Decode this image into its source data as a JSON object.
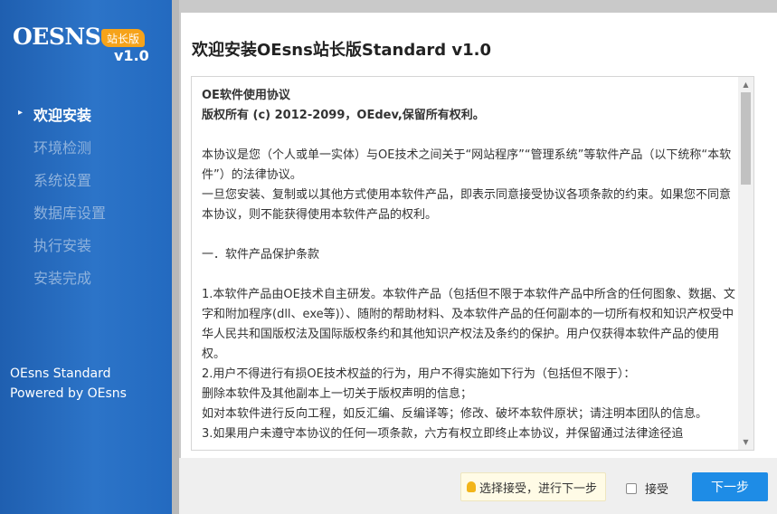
{
  "sidebar": {
    "logo_text": "OESNS",
    "logo_badge": "站长版",
    "version": "v1.0",
    "steps": [
      {
        "label": "欢迎安装",
        "active": true
      },
      {
        "label": "环境检测",
        "active": false
      },
      {
        "label": "系统设置",
        "active": false
      },
      {
        "label": "数据库设置",
        "active": false
      },
      {
        "label": "执行安装",
        "active": false
      },
      {
        "label": "安装完成",
        "active": false
      }
    ],
    "product_name": "OEsns Standard",
    "powered_by": "Powered by OEsns"
  },
  "main": {
    "title": "欢迎安装OEsns站长版Standard v1.0",
    "license": {
      "heading": "OE软件使用协议",
      "copyright": "版权所有 (c) 2012-2099，OEdev,保留所有权利。",
      "p1": "本协议是您（个人或单一实体）与OE技术之间关于“网站程序”“管理系统”等软件产品（以下统称“本软件”）的法律协议。",
      "p2": "一旦您安装、复制或以其他方式使用本软件产品，即表示同意接受协议各项条款的约束。如果您不同意本协议，则不能获得使用本软件产品的权利。",
      "section1": "一．软件产品保护条款",
      "p3": "1.本软件产品由OE技术自主研发。本软件产品（包括但不限于本软件产品中所含的任何图象、数据、文字和附加程序(dll、exe等)）、随附的帮助材料、及本软件产品的任何副本的一切所有权和知识产权受中华人民共和国版权法及国际版权条约和其他知识产权法及条约的保护。用户仅获得本软件产品的使用权。",
      "p4": "2.用户不得进行有损OE技术权益的行为，用户不得实施如下行为（包括但不限于）：",
      "p5": "删除本软件及其他副本上一切关于版权声明的信息；",
      "p6": "如对本软件进行反向工程，如反汇编、反编译等；修改、破坏本软件原状；请注明本团队的信息。",
      "p7": "3.如果用户未遵守本协议的任何一项条款，六方有权立即终止本协议，并保留通过法律途径追"
    }
  },
  "bottom": {
    "tip": "选择接受，进行下一步",
    "accept_label": "接受",
    "accept_checked": false,
    "next_label": "下一步"
  }
}
